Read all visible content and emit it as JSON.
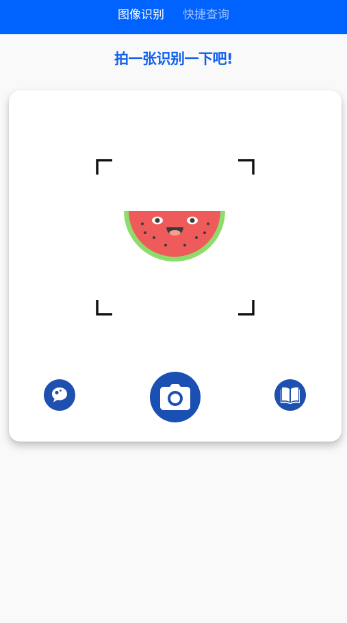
{
  "header": {
    "tabs": [
      {
        "label": "图像识别",
        "active": true
      },
      {
        "label": "快捷查询",
        "active": false
      }
    ]
  },
  "main": {
    "headline": "拍一张识别一下吧!"
  },
  "icons": {
    "left_button": "chat-bubble-icon",
    "center_button": "camera-icon",
    "right_button": "book-icon",
    "illustration": "watermelon-icon"
  },
  "colors": {
    "header_bg": "#0062ff",
    "headline": "#1060ee",
    "button_bg": "#1e50b0",
    "page_bg": "#f9f9f9",
    "card_bg": "#ffffff"
  }
}
